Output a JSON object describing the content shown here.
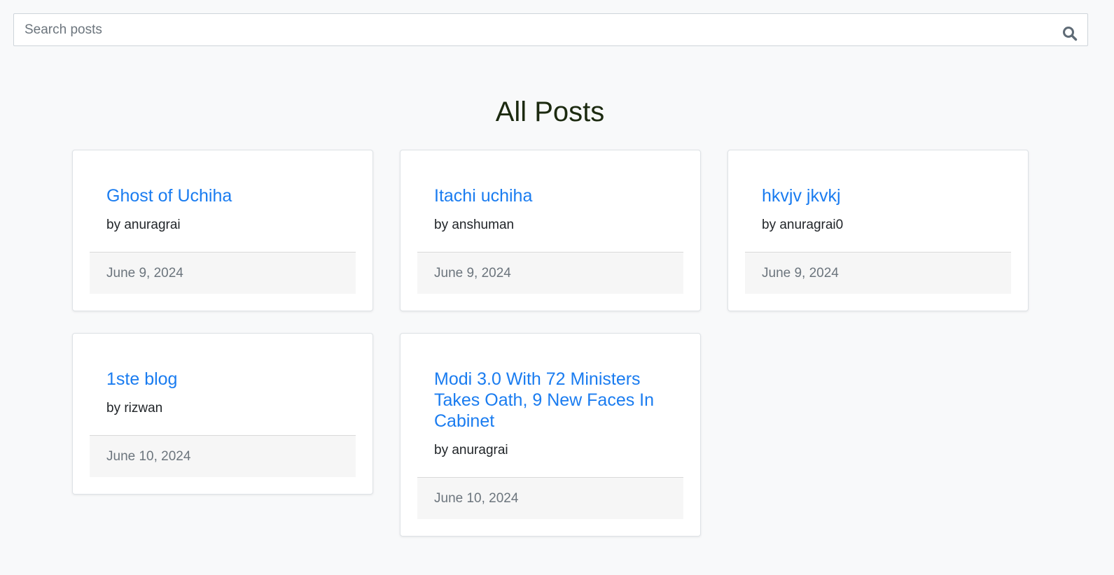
{
  "search": {
    "placeholder": "Search posts",
    "value": "",
    "icon": "search-icon"
  },
  "page": {
    "title": "All Posts"
  },
  "posts": [
    {
      "title": "Ghost of Uchiha",
      "author": "by anuragrai",
      "date": "June 9, 2024"
    },
    {
      "title": "Itachi uchiha",
      "author": "by anshuman",
      "date": "June 9, 2024"
    },
    {
      "title": "hkvjv jkvkj",
      "author": "by anuragrai0",
      "date": "June 9, 2024"
    },
    {
      "title": "1ste blog",
      "author": "by rizwan",
      "date": "June 10, 2024"
    },
    {
      "title": "Modi 3.0 With 72 Ministers Takes Oath, 9 New Faces In Cabinet",
      "author": "by anuragrai",
      "date": "June 10, 2024"
    }
  ],
  "colors": {
    "link": "#1a7cf0",
    "title": "#1c2a10",
    "background": "#f8f9fa",
    "footer_text": "#6c757d"
  }
}
